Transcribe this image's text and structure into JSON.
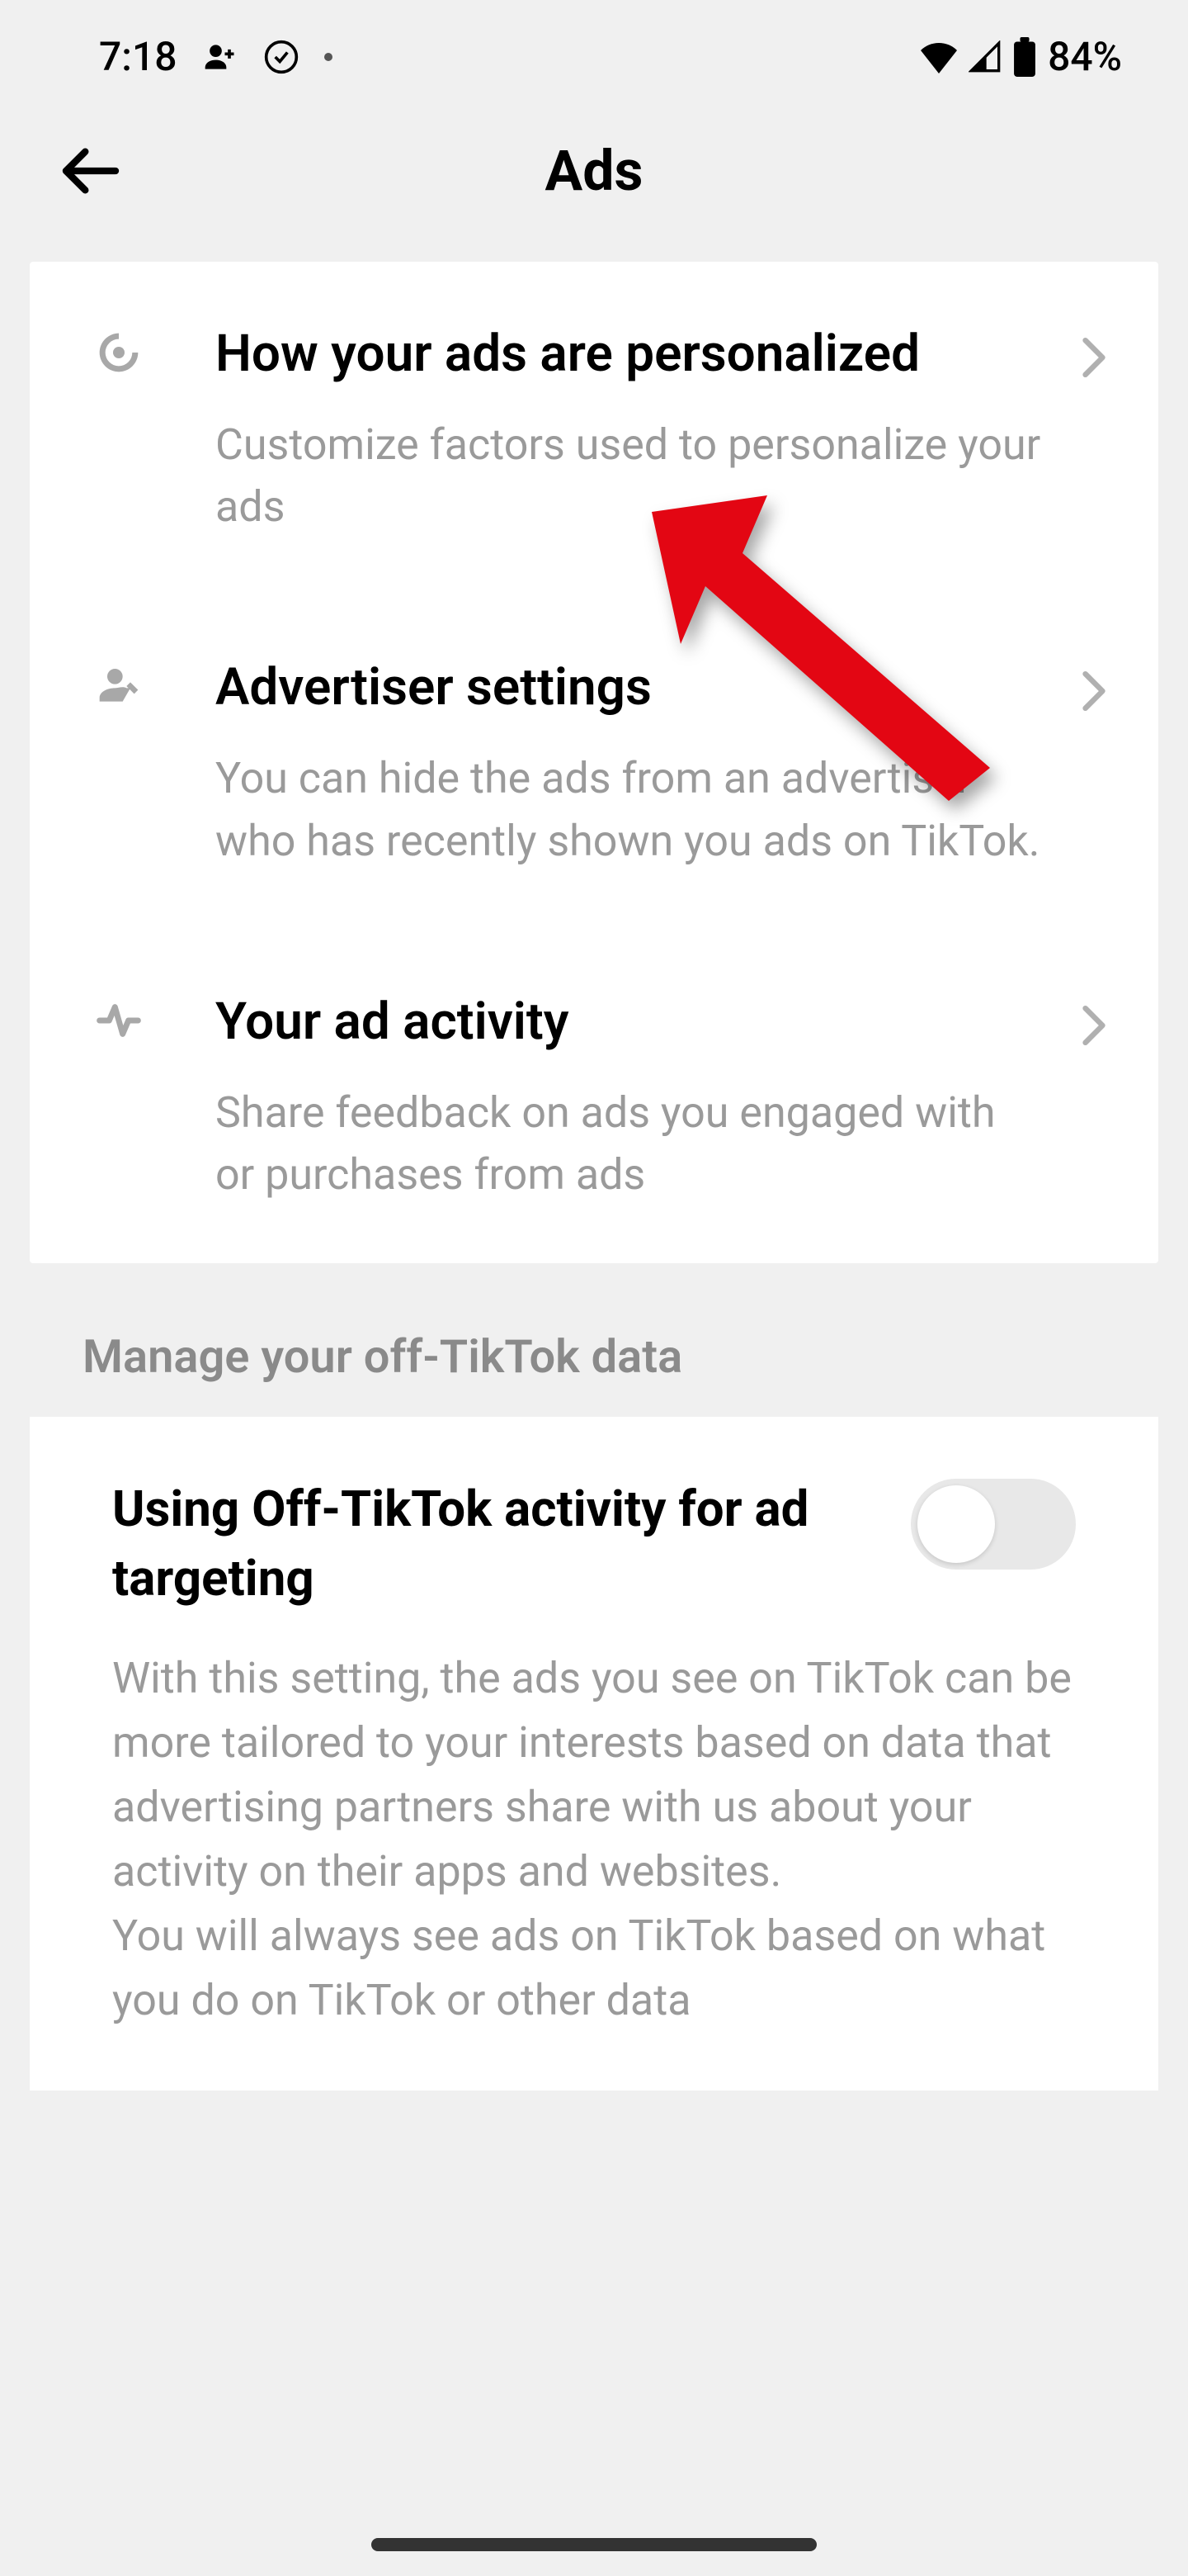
{
  "status_bar": {
    "time": "7:18",
    "battery_percent": "84%"
  },
  "header": {
    "title": "Ads"
  },
  "settings": [
    {
      "title": "How your ads are personalized",
      "subtitle": "Customize factors used to personalize your ads"
    },
    {
      "title": "Advertiser settings",
      "subtitle": "You can hide the ads from an advertiser who has recently shown you ads on TikTok."
    },
    {
      "title": "Your ad activity",
      "subtitle": "Share feedback on ads you engaged with or purchases from ads"
    }
  ],
  "section_header": "Manage your off-TikTok data",
  "toggle": {
    "title": "Using Off-TikTok activity for ad targeting",
    "description": "With this setting, the ads you see on TikTok can be more tailored to your interests based on data that advertising partners share with us about your activity on their apps and websites.\nYou will always see ads on TikTok based on what you do on TikTok or other data"
  }
}
